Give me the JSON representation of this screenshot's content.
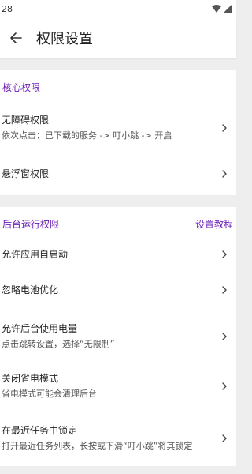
{
  "status_bar": {
    "time": "28"
  },
  "header": {
    "title": "权限设置"
  },
  "sections": [
    {
      "title": "核心权限",
      "items": [
        {
          "title": "无障碍权限",
          "subtitle": "依次点击：已下载的服务 -> 叮小跳 -> 开启"
        },
        {
          "title": "悬浮窗权限"
        }
      ]
    },
    {
      "title": "后台运行权限",
      "link": "设置教程",
      "items": [
        {
          "title": "允许应用自启动"
        },
        {
          "title": "忽略电池优化"
        },
        {
          "title": "允许后台使用电量",
          "subtitle": "点击跳转设置，选择“无限制”"
        },
        {
          "title": "关闭省电模式",
          "subtitle": "省电模式可能会清理后台"
        },
        {
          "title": "在最近任务中锁定",
          "subtitle": "打开最近任务列表，长按或下滑“叮小跳”将其锁定"
        }
      ]
    }
  ],
  "colors": {
    "accent": "#6a1bb3",
    "background": "#eeeeee",
    "surface": "#ffffff"
  },
  "icons": {
    "back": "arrow-left-icon",
    "row_action": "chevron-right-icon",
    "status": [
      "wifi-icon",
      "signal-icon"
    ]
  }
}
